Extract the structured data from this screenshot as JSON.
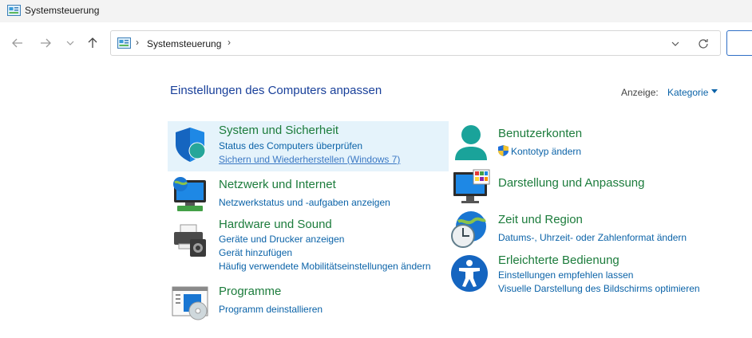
{
  "window": {
    "title": "Systemsteuerung",
    "icon": "control-panel-icon"
  },
  "nav": {
    "back": "arrow-left-icon",
    "forward": "arrow-right-icon",
    "recent": "chevron-down-icon",
    "up": "arrow-up-icon"
  },
  "address": {
    "crumb": "Systemsteuerung",
    "separator": "›"
  },
  "main": {
    "heading": "Einstellungen des Computers anpassen",
    "view_label": "Anzeige:",
    "view_value": "Kategorie"
  },
  "categories": [
    {
      "title": "System und Sicherheit",
      "icon": "shield-icon",
      "links": [
        "Status des Computers überprüfen",
        "Sichern und Wiederherstellen (Windows 7)"
      ]
    },
    {
      "title": "Netzwerk und Internet",
      "icon": "network-globe-icon",
      "links": [
        "Netzwerkstatus und -aufgaben anzeigen"
      ]
    },
    {
      "title": "Hardware und Sound",
      "icon": "printer-speaker-icon",
      "links": [
        "Geräte und Drucker anzeigen",
        "Gerät hinzufügen",
        "Häufig verwendete Mobilitätseinstellungen ändern"
      ]
    },
    {
      "title": "Programme",
      "icon": "programs-icon",
      "links": [
        "Programm deinstallieren"
      ]
    },
    {
      "title": "Benutzerkonten",
      "icon": "user-accounts-icon",
      "links": [
        "Kontotyp ändern"
      ]
    },
    {
      "title": "Darstellung und Anpassung",
      "icon": "monitor-personalize-icon",
      "links": []
    },
    {
      "title": "Zeit und Region",
      "icon": "clock-globe-icon",
      "links": [
        "Datums-, Uhrzeit- oder Zahlenformat ändern"
      ]
    },
    {
      "title": "Erleichterte Bedienung",
      "icon": "accessibility-icon",
      "links": [
        "Einstellungen empfehlen lassen",
        "Visuelle Darstellung des Bildschirms optimieren"
      ]
    }
  ],
  "colors": {
    "title_green": "#1c7c3c",
    "link_blue": "#0b63a8",
    "heading_blue": "#19409a",
    "highlight": "#e5f3fb"
  }
}
